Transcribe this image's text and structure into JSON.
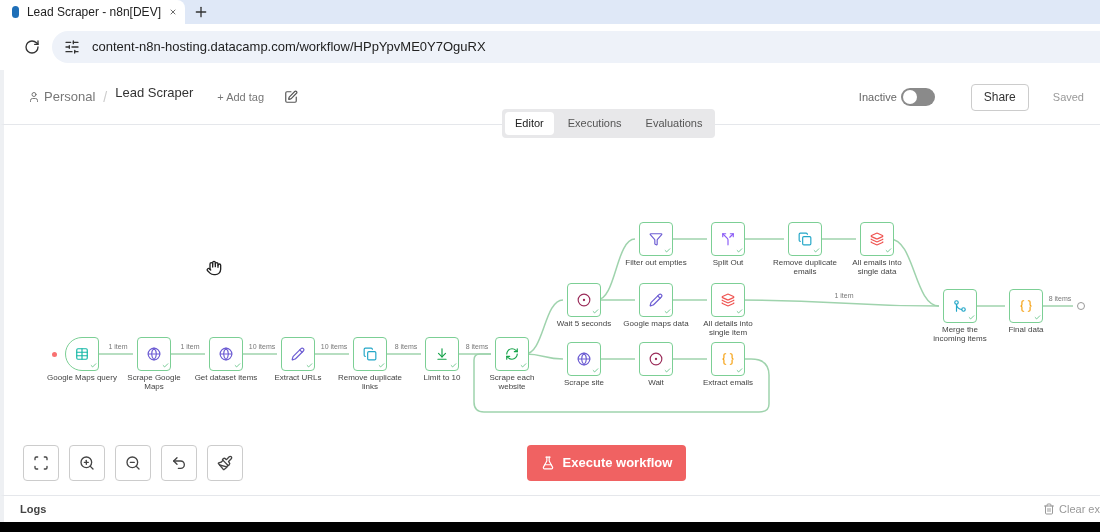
{
  "browser": {
    "tab_title": "Lead Scraper - n8n[DEV]",
    "url": "content-n8n-hosting.datacamp.com/workflow/HPpYpvME0Y7OguRX"
  },
  "header": {
    "project": "Personal",
    "separator": "/",
    "workflow_name": "Lead Scraper",
    "add_tag": "+ Add tag",
    "active_label": "Inactive",
    "active": false,
    "share": "Share",
    "save_state": "Saved"
  },
  "view_tabs": [
    {
      "label": "Editor",
      "selected": true
    },
    {
      "label": "Executions",
      "selected": false
    },
    {
      "label": "Evaluations",
      "selected": false
    }
  ],
  "nodes": [
    {
      "name": "Google Maps query",
      "kind": "trigger",
      "succeeded": true,
      "output_label": "1 item"
    },
    {
      "name": "Scrape Google Maps",
      "kind": "http",
      "succeeded": true,
      "output_label": "1 item"
    },
    {
      "name": "Get dataset items",
      "kind": "http",
      "succeeded": true,
      "output_label": "10 items"
    },
    {
      "name": "Extract URLs",
      "kind": "set",
      "succeeded": true,
      "output_label": "10 items"
    },
    {
      "name": "Remove duplicate links",
      "kind": "dedupe",
      "succeeded": true,
      "output_label": "8 items"
    },
    {
      "name": "Limit to 10",
      "kind": "limit",
      "succeeded": true,
      "output_label": "8 items"
    },
    {
      "name": "Scrape each website",
      "kind": "loop",
      "succeeded": true
    },
    {
      "name": "Wait 5 seconds",
      "kind": "wait",
      "succeeded": true
    },
    {
      "name": "Scrape site",
      "kind": "http",
      "succeeded": true
    },
    {
      "name": "Filter out empties",
      "kind": "filter",
      "succeeded": true
    },
    {
      "name": "Google maps data",
      "kind": "set",
      "succeeded": true
    },
    {
      "name": "Wait",
      "kind": "wait",
      "succeeded": true
    },
    {
      "name": "Split Out",
      "kind": "split",
      "succeeded": true
    },
    {
      "name": "All details into single item",
      "kind": "aggregate",
      "succeeded": true,
      "output_label": "1 item"
    },
    {
      "name": "Extract emails",
      "kind": "code",
      "succeeded": true
    },
    {
      "name": "Remove duplicate emails",
      "kind": "dedupe",
      "succeeded": true
    },
    {
      "name": "All emails into single data",
      "kind": "aggregate",
      "succeeded": true
    },
    {
      "name": "Merge the incoming items",
      "kind": "merge",
      "succeeded": true
    },
    {
      "name": "Final data",
      "kind": "code",
      "succeeded": true,
      "output_label": "8 items"
    }
  ],
  "canvas_controls": {
    "execute": "Execute workflow"
  },
  "logs": {
    "title": "Logs",
    "clear": "Clear ex"
  }
}
